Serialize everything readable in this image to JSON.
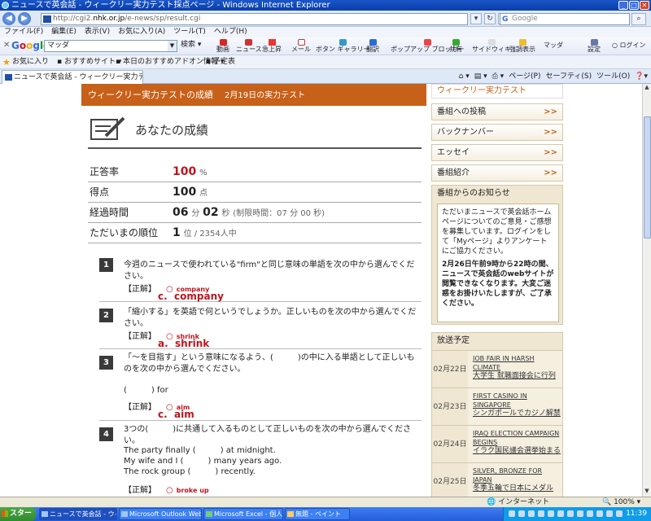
{
  "window": {
    "title": "ニュースで英会話 - ウィークリー実力テスト採点ページ - Windows Internet Explorer"
  },
  "address": {
    "url_prefix": "http://cgi2.",
    "url_host": "nhk.or.jp",
    "url_path": "/e-news/sp/result.cgi",
    "search_placeholder": "Google"
  },
  "menu": [
    "ファイル(F)",
    "編集(E)",
    "表示(V)",
    "お気に入り(A)",
    "ツール(T)",
    "ヘルプ(H)"
  ],
  "google_toolbar": {
    "query": "マッダ",
    "search_label": "検索",
    "buttons": [
      "動画",
      "ニュース",
      "急上昇",
      "メール",
      "ボタン ギャラリー",
      "翻訳",
      "ポップアップ ブロッカー",
      "共有",
      "サイドウィキ",
      "強調表示",
      "マッダ",
      "設定",
      "ログイン"
    ]
  },
  "favorites": {
    "label": "お気に入り",
    "items": [
      "おすすめサイト",
      "本日のおすすめアドオン情報",
      "予定表"
    ]
  },
  "tab": {
    "label": "ニュースで英会話 - ウィークリー実力テスト採点ページ",
    "commands": [
      "ページ(P)",
      "セーフティ(S)",
      "ツール(O)"
    ]
  },
  "page": {
    "header": "ウィークリー実力テストの成績",
    "header_date": "2月19日の実力テスト",
    "result_title": "あなたの成績",
    "stats": {
      "accuracy_label": "正答率",
      "accuracy_value": "100",
      "accuracy_unit": "%",
      "score_label": "得点",
      "score_value": "100",
      "score_unit": "点",
      "time_label": "経過時間",
      "time_min": "06",
      "time_min_unit": "分",
      "time_sec": "02",
      "time_sec_unit": "秒",
      "time_limit": "(制限時間：07 分 00 秒)",
      "rank_label": "ただいまの順位",
      "rank_value": "1",
      "rank_unit": "位 / 2354人中"
    },
    "answer_label": "【正解】",
    "questions": [
      {
        "num": "1",
        "text": "今週のニュースで使われている\"firm\"と同じ意味の単語を次の中から選んでください。",
        "answer_small": "company",
        "answer_choice": "c.",
        "answer_big": "company"
      },
      {
        "num": "2",
        "text": "「縮小する」を英語で何というでしょうか。正しいものを次の中から選んでください。",
        "answer_small": "shrink",
        "answer_choice": "a.",
        "answer_big": "shrink"
      },
      {
        "num": "3",
        "text": "「～を目指す」という意味になるよう、(　　　)の中に入る単語として正しいものを次の中から選んでください。",
        "sentence": "(　　　) for",
        "answer_small": "aim",
        "answer_choice": "c.",
        "answer_big": "aim"
      },
      {
        "num": "4",
        "text": "3つの(　　　)に共通して入るものとして正しいものを次の中から選んでください。",
        "sentences": [
          "The party finally (　　　) at midnight.",
          "My wife and I (　　　)  many years ago.",
          "The rock group (　　　) recently."
        ],
        "answer_small": "broke up"
      }
    ]
  },
  "sidebar": {
    "top": "ウィークリー実力テスト",
    "links": [
      "番組への投稿",
      "バックナンバー",
      "エッセイ",
      "番組紹介"
    ],
    "notice_title": "番組からのお知らせ",
    "notice_text": "ただいまニュースで英会話ホームページについてのご意見・ご感想を募集しています。ログインをして「Myページ」よりアンケートにご協力ください。",
    "notice_bold": "2月26日午前9時から22時の間、ニュースで英会話のwebサイトが閲覧できなくなります。大変ご迷惑をお掛けいたしますが、ご了承ください。",
    "schedule_title": "放送予定",
    "schedule": [
      {
        "date": "02月22日",
        "en": "JOB FAIR IN HARSH CLIMATE",
        "ja": "大学生 就職面接会に行列"
      },
      {
        "date": "02月23日",
        "en": "FIRST CASINO IN SINGAPORE",
        "ja": "シンガポールでカジノ解禁"
      },
      {
        "date": "02月24日",
        "en": "IRAQ ELECTION CAMPAIGN BEGINS",
        "ja": "イラク国民議会選挙始まる"
      },
      {
        "date": "02月25日",
        "en": "SILVER, BRONZE FOR JAPAN",
        "ja": "冬季五輪で日本にメダル"
      }
    ]
  },
  "status": {
    "zone": "インターネット",
    "zoom": "100%"
  },
  "taskbar": {
    "start": "スタート",
    "tasks": [
      "ニュースで英会話 - ウィ...",
      "Microsoft Outlook Web A...",
      "Microsoft Excel - 個人ス...",
      "無題 - ペイント"
    ],
    "clock": "11:39"
  },
  "colors": {
    "header": "#c76019",
    "correct": "#c0141c"
  }
}
